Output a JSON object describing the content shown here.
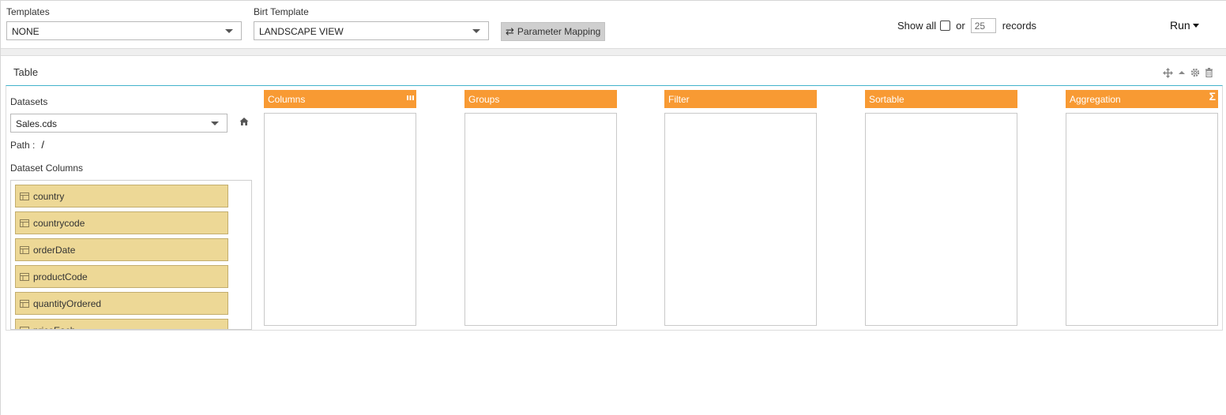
{
  "toolbar": {
    "templates_label": "Templates",
    "templates_value": "NONE",
    "birt_label": "Birt Template",
    "birt_value": "LANDSCAPE VIEW",
    "param_mapping_label": "Parameter Mapping",
    "show_all_label": "Show all",
    "or_label": "or",
    "records_value": "25",
    "records_label": "records",
    "run_label": "Run"
  },
  "panel": {
    "title": "Table",
    "datasets_label": "Datasets",
    "dataset_value": "Sales.cds",
    "path_label": "Path :",
    "path_value": "/",
    "dataset_columns_label": "Dataset Columns",
    "columns": [
      "country",
      "countrycode",
      "orderDate",
      "productCode",
      "quantityOrdered",
      "priceEach"
    ]
  },
  "zones": [
    "Columns",
    "Groups",
    "Filter",
    "Sortable",
    "Aggregation"
  ],
  "colors": {
    "zone_header": "#f89a33",
    "column_item": "#edd896",
    "panel_accent": "#43b3cc"
  },
  "icons": [
    "chevron-down-icon",
    "swap-icon",
    "checkbox-icon",
    "move-icon",
    "collapse-icon",
    "gear-icon",
    "trash-icon",
    "home-icon",
    "field-icon",
    "columns-icon",
    "sigma-icon"
  ]
}
